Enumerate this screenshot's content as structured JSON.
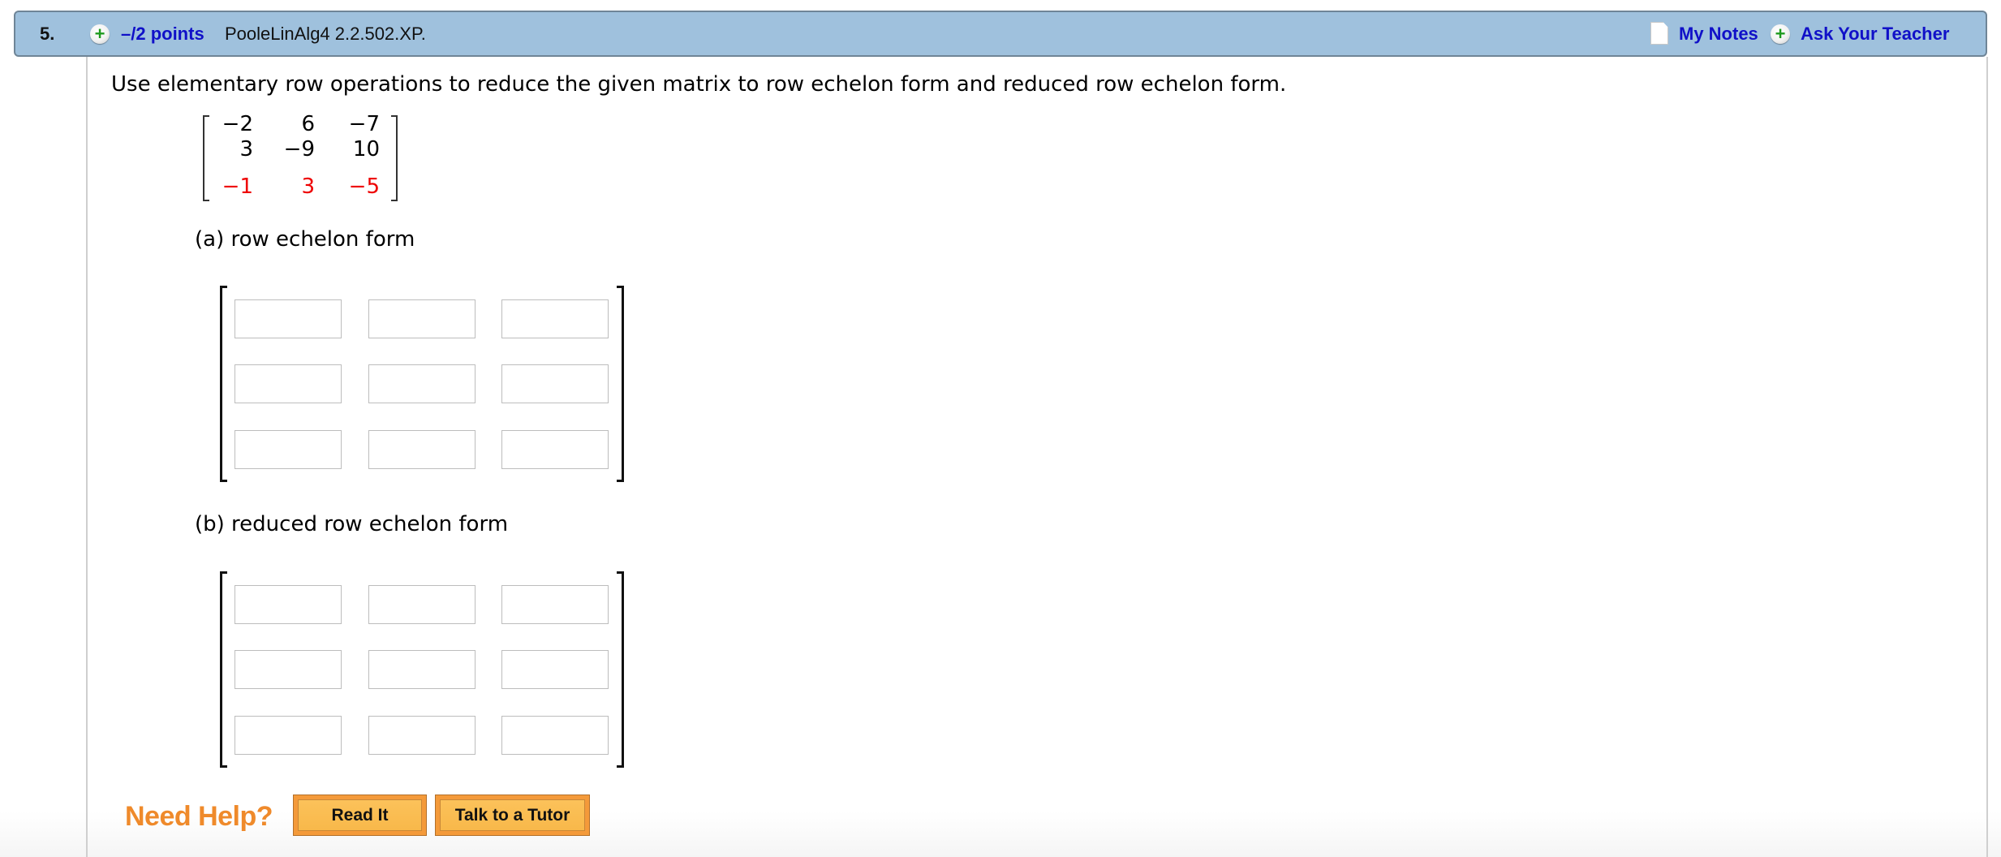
{
  "header": {
    "question_number": "5.",
    "points": "–/2 points",
    "source": "PooleLinAlg4 2.2.502.XP.",
    "my_notes": "My Notes",
    "ask_teacher": "Ask Your Teacher",
    "icons": {
      "expand": "plus-circle-icon",
      "notes": "note-page-icon",
      "ask": "plus-circle-icon"
    }
  },
  "question": {
    "prompt": "Use elementary row operations to reduce the given matrix to row echelon form and reduced row echelon form.",
    "matrix": [
      [
        "−2",
        "6",
        "−7"
      ],
      [
        "3",
        "−9",
        "10"
      ],
      [
        "−1",
        "3",
        "−5"
      ]
    ],
    "highlight_row_color": "#ee0000"
  },
  "parts": [
    {
      "label": "(a) row echelon form",
      "inputs": [
        [
          "",
          "",
          ""
        ],
        [
          "",
          "",
          ""
        ],
        [
          "",
          "",
          ""
        ]
      ]
    },
    {
      "label": "(b) reduced row echelon form",
      "inputs": [
        [
          "",
          "",
          ""
        ],
        [
          "",
          "",
          ""
        ],
        [
          "",
          "",
          ""
        ]
      ]
    }
  ],
  "help": {
    "label": "Need Help?",
    "read_it": "Read It",
    "tutor": "Talk to a Tutor"
  },
  "colors": {
    "header_bg": "#9fc1dd",
    "link": "#1010c8",
    "help_orange": "#ef8a2b"
  }
}
